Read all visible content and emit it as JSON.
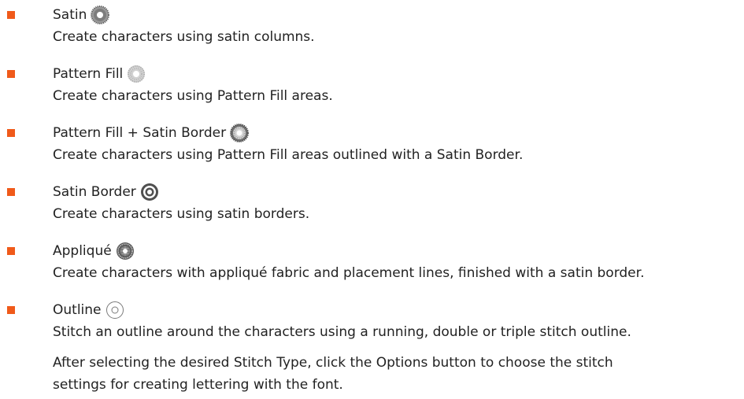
{
  "bullet_color": "#f05a1a",
  "stitch_types": [
    {
      "title": "Satin",
      "icon": "satin-icon",
      "description": "Create characters using satin columns."
    },
    {
      "title": "Pattern Fill",
      "icon": "pattern-fill-icon",
      "description": "Create characters using Pattern Fill areas."
    },
    {
      "title": "Pattern Fill + Satin Border",
      "icon": "pattern-fill-satin-border-icon",
      "description": "Create characters using Pattern Fill areas outlined with a Satin Border."
    },
    {
      "title": "Satin Border",
      "icon": "satin-border-icon",
      "description": "Create characters using satin borders."
    },
    {
      "title": "Appliqué",
      "icon": "applique-icon",
      "description": "Create characters with appliqué fabric and placement lines, finished with a satin border."
    },
    {
      "title": "Outline",
      "icon": "outline-icon",
      "description": "Stitch an outline around the characters using a running, double or triple stitch outline."
    }
  ],
  "after_text": "After selecting the desired Stitch Type, click the Options button to choose the stitch settings for creating lettering with the font."
}
